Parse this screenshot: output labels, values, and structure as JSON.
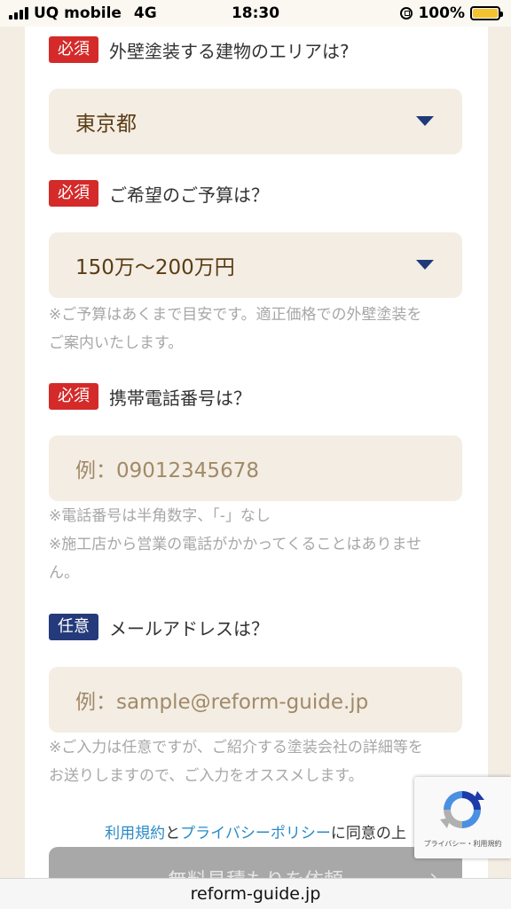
{
  "status_bar": {
    "carrier": "UQ mobile",
    "network": "4G",
    "time": "18:30",
    "battery": "100%"
  },
  "form": {
    "area": {
      "badge": "必須",
      "question": "外壁塗装する建物のエリアは?",
      "value": "東京都"
    },
    "budget": {
      "badge": "必須",
      "question": "ご希望のご予算は？",
      "value": "150万〜200万円",
      "note_line1": "※ご予算はあくまで目安です。適正価格での外壁塗装を",
      "note_line2": "ご案内いたします。"
    },
    "phone": {
      "badge": "必須",
      "question": "携帯電話番号は？",
      "placeholder": "例：09012345678",
      "note_line1": "※電話番号は半角数字、「-」なし",
      "note_line2": "※施工店から営業の電話がかかってくることはありませ",
      "note_line3": "ん。"
    },
    "email": {
      "badge": "任意",
      "question": "メールアドレスは？",
      "placeholder": "例：sample@reform-guide.jp",
      "note_line1": "※ご入力は任意ですが、ご紹介する塗装会社の詳細等を",
      "note_line2": "お送りしますので、ご入力をオススメします。"
    },
    "agreement": {
      "terms_link": "利用規約",
      "and": "と",
      "privacy_link": "プライバシーポリシー",
      "suffix": "に同意の上"
    },
    "submit_label": "無料見積もりを依頼"
  },
  "recaptcha": {
    "text": "プライバシー・利用規約"
  },
  "url_bar": {
    "domain": "reform-guide.jp"
  },
  "colors": {
    "required_badge": "#d42a2a",
    "optional_badge": "#243a7a",
    "field_bg": "#f4ede3",
    "link": "#2a8bc9",
    "caret": "#1f3a7a"
  }
}
